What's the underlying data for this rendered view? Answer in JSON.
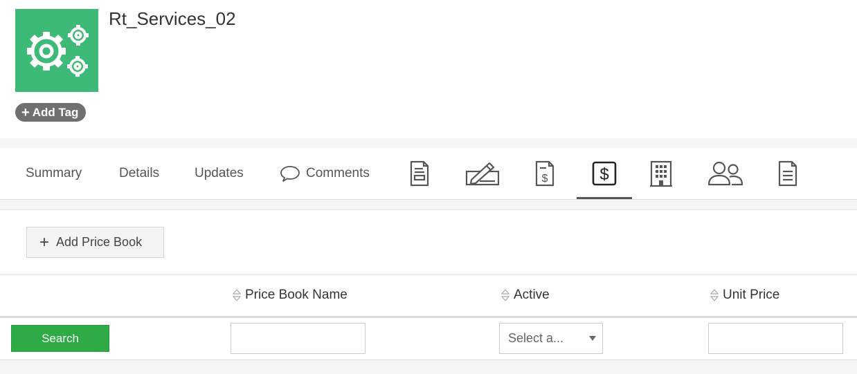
{
  "record": {
    "title": "Rt_Services_02",
    "logo_icon": "gears-icon",
    "logo_color": "#3dba78",
    "add_tag_label": "Add Tag"
  },
  "tabs": {
    "summary": "Summary",
    "details": "Details",
    "updates": "Updates",
    "comments": "Comments",
    "icon_tabs": [
      "document-form-icon",
      "signature-icon",
      "invoice-icon",
      "price-book-icon",
      "building-icon",
      "contacts-icon",
      "notes-icon"
    ],
    "active_tab": "price-book-icon"
  },
  "price_book": {
    "add_label": "Add Price Book",
    "columns": {
      "name": "Price Book Name",
      "active": "Active",
      "unit_price": "Unit Price"
    },
    "search_label": "Search",
    "active_select": "Select a...",
    "search_button_color": "#2eaa47"
  }
}
